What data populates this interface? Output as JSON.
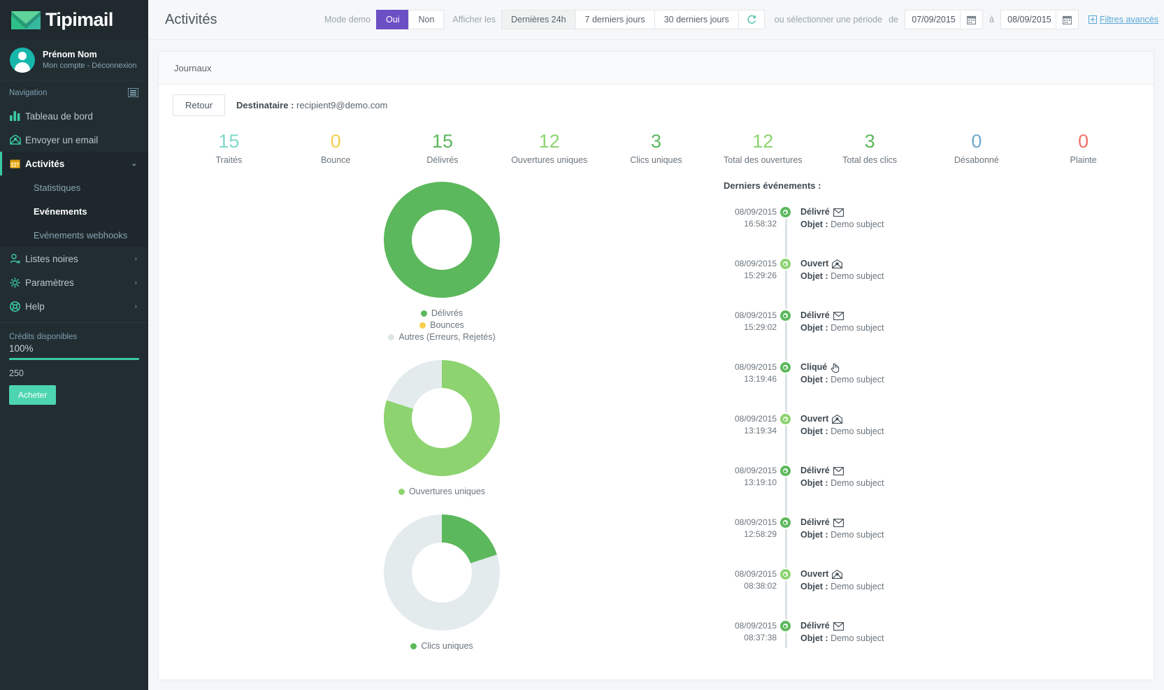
{
  "brand": {
    "name": "Tipimail",
    "logo_icon": "envelope-logo-icon"
  },
  "user": {
    "name": "Prénom Nom",
    "links": "Mon compte - Déconnexion",
    "avatar_icon": "avatar-icon"
  },
  "sidebar": {
    "nav_header": "Navigation",
    "collapse_icon": "collapse-sidebar-icon",
    "items": [
      {
        "label": "Tableau de bord",
        "icon": "bar-chart-icon",
        "arrow": ""
      },
      {
        "label": "Envoyer un email",
        "icon": "send-email-icon",
        "arrow": ""
      },
      {
        "label": "Activités",
        "icon": "calendar-icon",
        "arrow": "⌄",
        "active": true
      },
      {
        "label": "Listes noires",
        "icon": "user-block-icon",
        "arrow": "›"
      },
      {
        "label": "Paramètres",
        "icon": "gear-icon",
        "arrow": "›"
      },
      {
        "label": "Help",
        "icon": "lifebuoy-icon",
        "arrow": "›"
      }
    ],
    "subitems": [
      {
        "label": "Statistiques",
        "current": false
      },
      {
        "label": "Evénements",
        "current": true
      },
      {
        "label": "Evénements webhooks",
        "current": false
      }
    ],
    "credits": {
      "label": "Crédits disponibles",
      "percent": "100%",
      "count": "250",
      "buy_label": "Acheter",
      "bar_color": "#3ac9a0"
    }
  },
  "topbar": {
    "title": "Activités",
    "demo_label": "Mode demo",
    "demo_yes": "Oui",
    "demo_no": "Non",
    "show_label": "Afficher les",
    "ranges": [
      "Dernières 24h",
      "7 derniers jours",
      "30 derniers jours"
    ],
    "refresh_icon": "refresh-icon",
    "period_label": "ou sélectionner une période",
    "from_label": "de",
    "to_label": "à",
    "date_from": "07/09/2015",
    "date_to": "08/09/2015",
    "calendar_icon": "calendar-icon",
    "advanced_filters": "Filtres avancés",
    "advanced_filters_icon": "filter-grid-icon"
  },
  "panel": {
    "tab_label": "Journaux",
    "back_label": "Retour",
    "recipient_label": "Destinataire :",
    "recipient_value": "recipient9@demo.com"
  },
  "stats": [
    {
      "value": "15",
      "label": "Traités",
      "color": "#7fd9cd"
    },
    {
      "value": "0",
      "label": "Bounce",
      "color": "#f5cf4e"
    },
    {
      "value": "15",
      "label": "Délivrés",
      "color": "#5cb85c"
    },
    {
      "value": "12",
      "label": "Ouvertures uniques",
      "color": "#8dd370"
    },
    {
      "value": "3",
      "label": "Clics uniques",
      "color": "#5cb85c"
    },
    {
      "value": "12",
      "label": "Total des ouvertures",
      "color": "#8dd370"
    },
    {
      "value": "3",
      "label": "Total des clics",
      "color": "#5cb85c"
    },
    {
      "value": "0",
      "label": "Désabonné",
      "color": "#6fa8d0"
    },
    {
      "value": "0",
      "label": "Plainte",
      "color": "#f0736a"
    }
  ],
  "chart_data": [
    {
      "type": "pie",
      "title": "",
      "name": "delivery-donut",
      "categories": [
        "Délivrés",
        "Bounces",
        "Autres (Erreurs, Rejetés)"
      ],
      "values": [
        15,
        0,
        0
      ],
      "percentages": [
        100,
        0,
        0
      ],
      "colors": [
        "#5cb85c",
        "#f5cf4e",
        "#dde5e7"
      ],
      "legend_position": "bottom",
      "donut_hole": 0.52
    },
    {
      "type": "pie",
      "title": "",
      "name": "unique-opens-donut",
      "categories": [
        "Ouvertures uniques",
        "Reste"
      ],
      "values": [
        12,
        3
      ],
      "percentages": [
        80,
        20
      ],
      "colors": [
        "#8dd370",
        "#e3ebed"
      ],
      "legend_position": "bottom",
      "legend_entries": [
        "Ouvertures uniques"
      ],
      "donut_hole": 0.52
    },
    {
      "type": "pie",
      "title": "",
      "name": "unique-clicks-donut",
      "categories": [
        "Clics uniques",
        "Reste"
      ],
      "values": [
        3,
        12
      ],
      "percentages": [
        20,
        80
      ],
      "colors": [
        "#5cb85c",
        "#e3ebed"
      ],
      "legend_position": "bottom",
      "legend_entries": [
        "Clics uniques"
      ],
      "donut_hole": 0.52
    }
  ],
  "events": {
    "title": "Derniers événements :",
    "subject_label": "Objet :",
    "list": [
      {
        "date": "08/09/2015",
        "time": "16:58:32",
        "type": "Délivré",
        "icon": "envelope-icon",
        "marker": "dark",
        "subject": "Demo subject"
      },
      {
        "date": "08/09/2015",
        "time": "15:29:26",
        "type": "Ouvert",
        "icon": "envelope-open-icon",
        "marker": "light",
        "subject": "Demo subject"
      },
      {
        "date": "08/09/2015",
        "time": "15:29:02",
        "type": "Délivré",
        "icon": "envelope-icon",
        "marker": "dark",
        "subject": "Demo subject"
      },
      {
        "date": "08/09/2015",
        "time": "13:19:46",
        "type": "Cliqué",
        "icon": "hand-pointer-icon",
        "marker": "dark",
        "subject": "Demo subject"
      },
      {
        "date": "08/09/2015",
        "time": "13:19:34",
        "type": "Ouvert",
        "icon": "envelope-open-icon",
        "marker": "light",
        "subject": "Demo subject"
      },
      {
        "date": "08/09/2015",
        "time": "13:19:10",
        "type": "Délivré",
        "icon": "envelope-icon",
        "marker": "dark",
        "subject": "Demo subject"
      },
      {
        "date": "08/09/2015",
        "time": "12:58:29",
        "type": "Délivré",
        "icon": "envelope-icon",
        "marker": "dark",
        "subject": "Demo subject"
      },
      {
        "date": "08/09/2015",
        "time": "08:38:02",
        "type": "Ouvert",
        "icon": "envelope-open-icon",
        "marker": "light",
        "subject": "Demo subject"
      },
      {
        "date": "08/09/2015",
        "time": "08:37:38",
        "type": "Délivré",
        "icon": "envelope-icon",
        "marker": "dark",
        "subject": "Demo subject"
      }
    ]
  }
}
